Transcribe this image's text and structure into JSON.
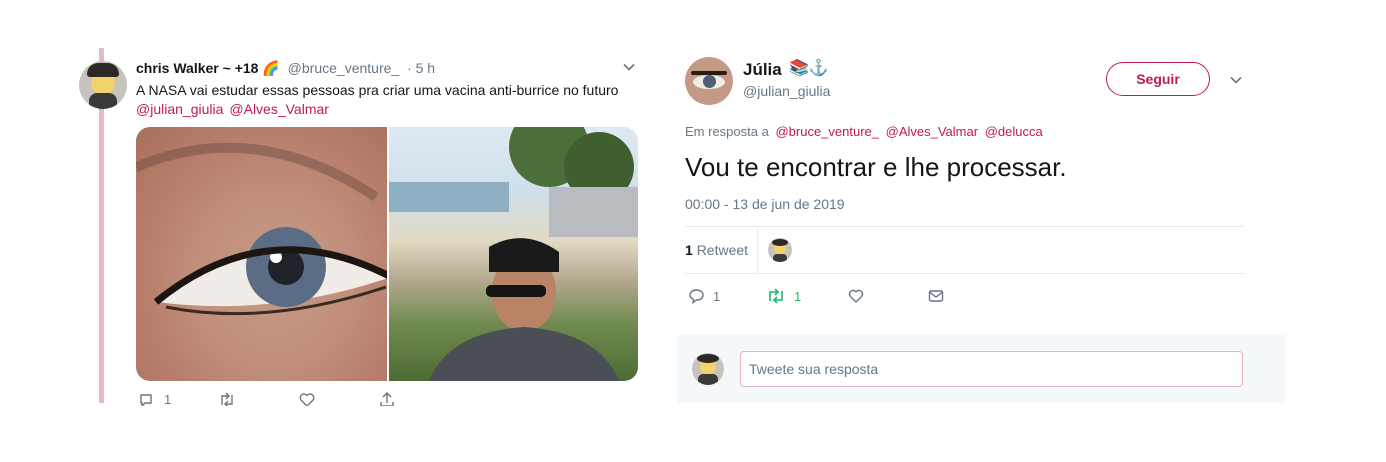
{
  "tweet1": {
    "author_name": "chris Walker ~ +18",
    "author_emoji": "🌈",
    "handle": "@bruce_venture_",
    "time": "· 5 h",
    "text": "A NASA vai estudar essas pessoas pra criar uma vacina anti-burrice no futuro",
    "mentions": [
      "@julian_giulia",
      "@Alves_Valmar"
    ],
    "reply_count": "1",
    "icons": [
      "reply-icon",
      "retweet-icon",
      "like-icon",
      "share-icon"
    ]
  },
  "tweet2": {
    "author_name": "Júlia",
    "author_badge": "📚⚓",
    "handle": "@julian_giulia",
    "follow_label": "Seguir",
    "reply_to_label": "Em resposta a",
    "reply_to_mentions": [
      "@bruce_venture_",
      "@Alves_Valmar",
      "@delucca"
    ],
    "text": "Vou te encontrar e lhe processar.",
    "timestamp": "00:00 - 13 de jun de 2019",
    "retweets_count": "1",
    "retweets_label": "Retweet",
    "actions": {
      "reply_count": "1",
      "retweet_count": "1"
    },
    "reply_placeholder": "Tweete sua resposta"
  },
  "colors": {
    "accent": "#c2185b",
    "retweet_green": "#17bf63",
    "muted": "#657786",
    "thread_line": "#e8b8c8"
  }
}
